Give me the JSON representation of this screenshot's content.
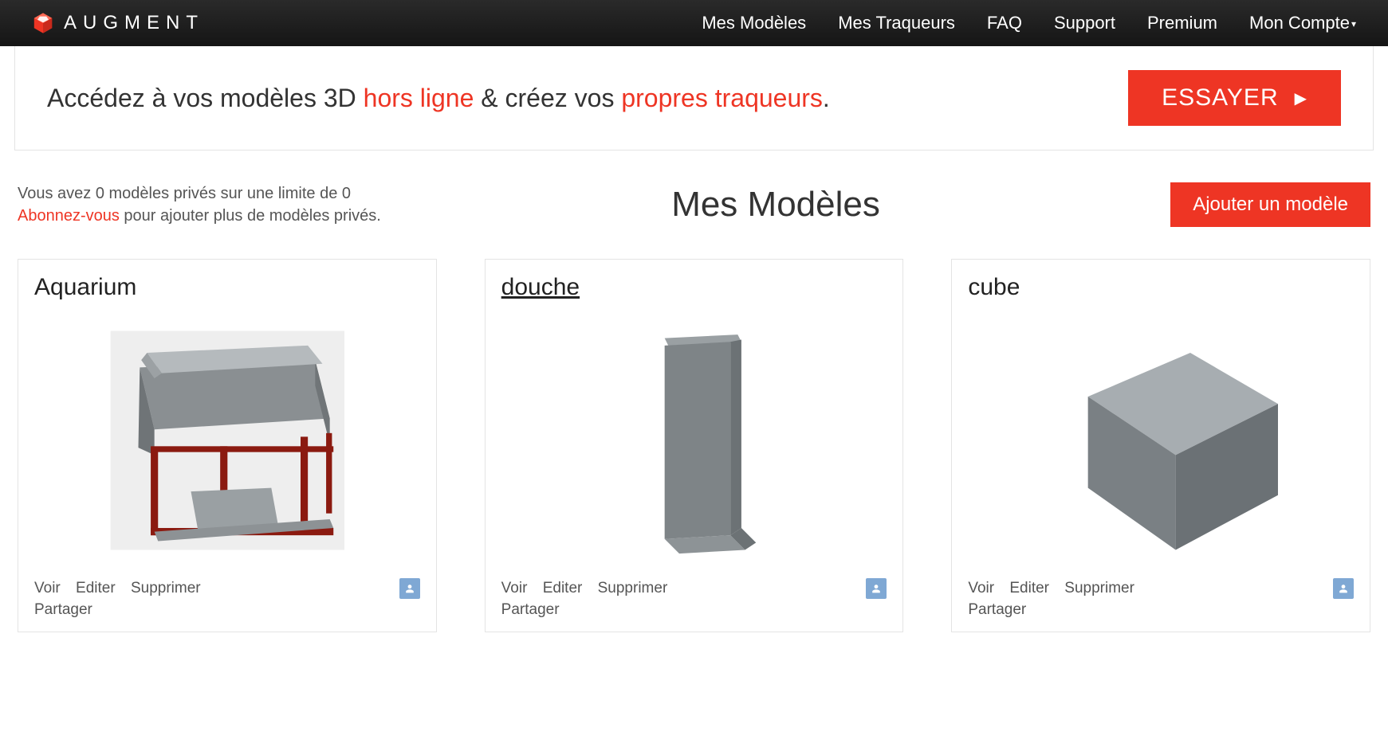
{
  "brand": "AUGMENT",
  "nav": {
    "items": [
      "Mes Modèles",
      "Mes Traqueurs",
      "FAQ",
      "Support",
      "Premium"
    ],
    "account": "Mon Compte"
  },
  "banner": {
    "t1": "Accédez à vos modèles 3D ",
    "accent1": "hors ligne",
    "t2": " & créez vos ",
    "accent2": "propres traqueurs",
    "t3": ".",
    "cta": "ESSAYER"
  },
  "quota": {
    "line1": "Vous avez 0 modèles privés sur une limite de 0",
    "sub_link": "Abonnez-vous",
    "line2_rest": " pour ajouter plus de modèles privés."
  },
  "page_title": "Mes Modèles",
  "add_button": "Ajouter un modèle",
  "actions": {
    "view": "Voir",
    "edit": "Editer",
    "delete": "Supprimer",
    "share": "Partager"
  },
  "models": [
    {
      "title": "Aquarium",
      "underline": false
    },
    {
      "title": "douche",
      "underline": true
    },
    {
      "title": "cube",
      "underline": false
    }
  ]
}
